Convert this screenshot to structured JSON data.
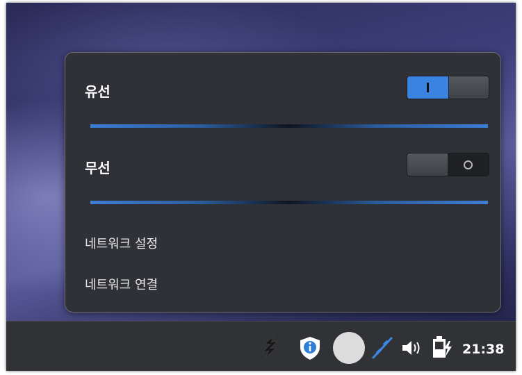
{
  "network_menu": {
    "wired": {
      "label": "유선",
      "enabled": true
    },
    "wireless": {
      "label": "무선",
      "enabled": false
    },
    "items": [
      {
        "label": "네트워크 설정"
      },
      {
        "label": "네트워크 연결"
      }
    ]
  },
  "taskbar": {
    "clock": "21:38",
    "tray_icons": [
      "app-logo-icon",
      "shield-info-icon",
      "status-circle-icon",
      "network-connection-icon",
      "volume-icon",
      "battery-charging-icon"
    ]
  },
  "colors": {
    "accent": "#3a83e0",
    "popup_bg": "#2f3136",
    "taskbar_bg": "#303236"
  }
}
